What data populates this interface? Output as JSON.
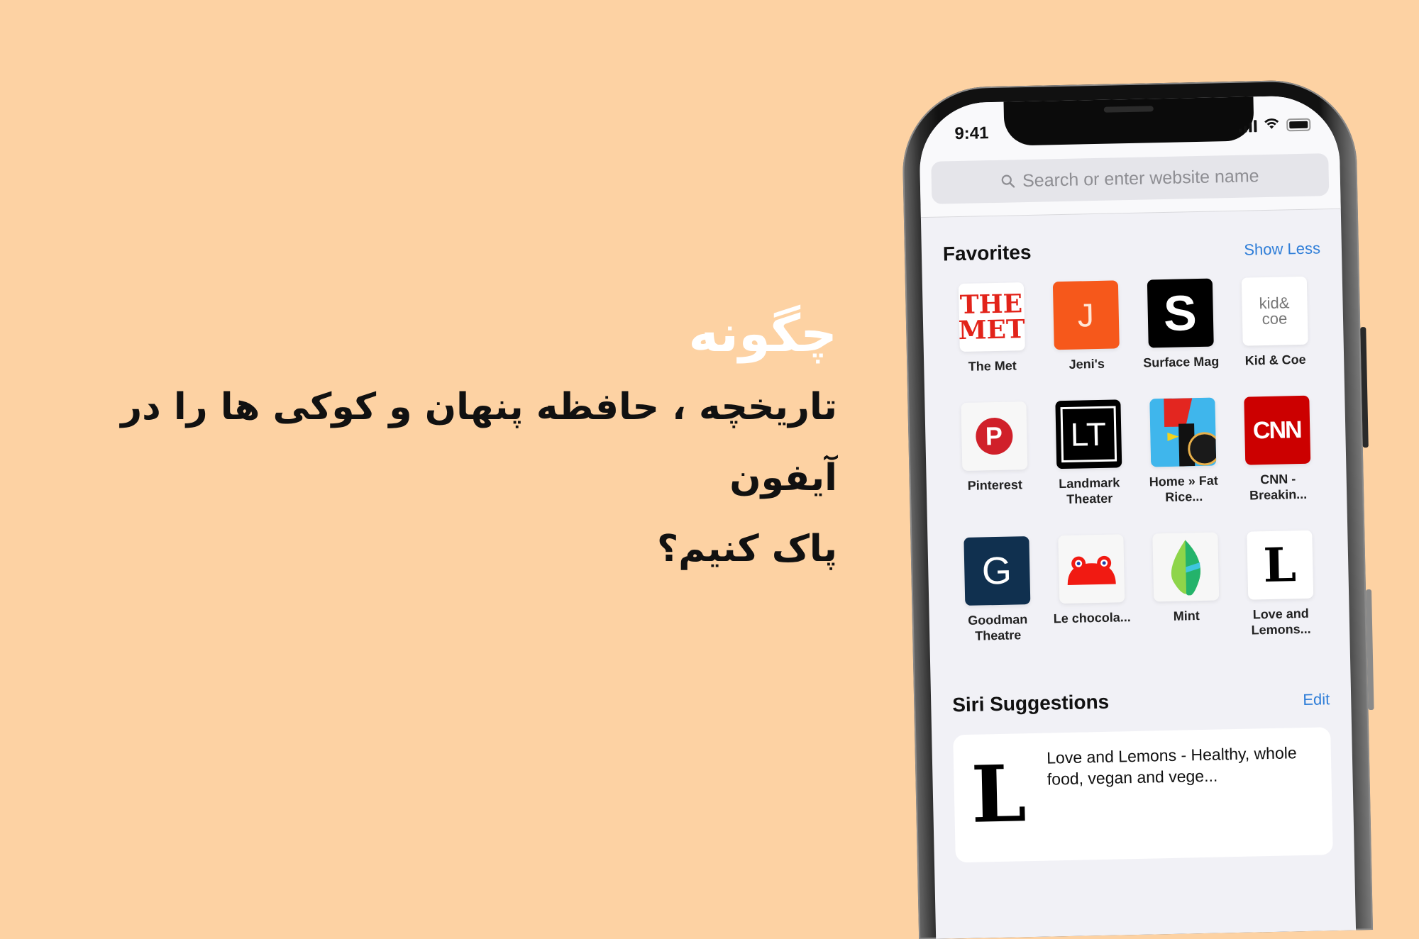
{
  "headline": {
    "kicker": "چگونه",
    "title_line1": "تاریخچه ، حافظه پنهان و کوکی ها را در آیفون",
    "title_line2": "پاک کنیم؟"
  },
  "phone": {
    "status_bar": {
      "time": "9:41",
      "icons": [
        "signal-icon",
        "wifi-icon",
        "battery-icon"
      ]
    },
    "search": {
      "placeholder": "Search or enter website name",
      "icon": "search-icon"
    },
    "favorites": {
      "title": "Favorites",
      "action": "Show Less",
      "items": [
        {
          "label": "The Met",
          "icon": "the-met-logo",
          "bg": "#ffffff",
          "fg": "#e2231a",
          "glyph": "THE MET"
        },
        {
          "label": "Jeni's",
          "icon": "jenis-logo",
          "bg": "#f6581b",
          "fg": "#ffe6d6",
          "glyph": "J"
        },
        {
          "label": "Surface Mag",
          "icon": "surface-mag-logo",
          "bg": "#000000",
          "fg": "#ffffff",
          "glyph": "S"
        },
        {
          "label": "Kid & Coe",
          "icon": "kid-and-coe-logo",
          "bg": "#ffffff",
          "fg": "#777777",
          "glyph": "kid& coe"
        },
        {
          "label": "Pinterest",
          "icon": "pinterest-logo",
          "bg": "#f7f7f7",
          "fg": "#d0202a",
          "glyph": "P"
        },
        {
          "label": "Landmark Theater",
          "icon": "landmark-theater-logo",
          "bg": "#000000",
          "fg": "#ffffff",
          "glyph": "LT"
        },
        {
          "label": "Home » Fat Rice...",
          "icon": "fat-rice-logo",
          "bg": "#3fb6ec",
          "fg": "#e32620",
          "glyph": ""
        },
        {
          "label": "CNN - Breakin...",
          "icon": "cnn-logo",
          "bg": "#cc0000",
          "fg": "#ffffff",
          "glyph": "CNN"
        },
        {
          "label": "Goodman Theatre",
          "icon": "goodman-theatre-logo",
          "bg": "#10304f",
          "fg": "#ffffff",
          "glyph": "G"
        },
        {
          "label": "Le chocola...",
          "icon": "le-chocolat-logo",
          "bg": "#f7f7f7",
          "fg": "#f11a12",
          "glyph": ""
        },
        {
          "label": "Mint",
          "icon": "mint-logo",
          "bg": "#f7f7f7",
          "fg": "#3cc565",
          "glyph": ""
        },
        {
          "label": "Love and Lemons...",
          "icon": "love-and-lemons-logo",
          "bg": "#ffffff",
          "fg": "#000000",
          "glyph": "L"
        }
      ]
    },
    "siri": {
      "title": "Siri Suggestions",
      "action": "Edit",
      "card": {
        "thumb": "L",
        "text": "Love and Lemons - Healthy, whole food, vegan and vege..."
      }
    }
  }
}
